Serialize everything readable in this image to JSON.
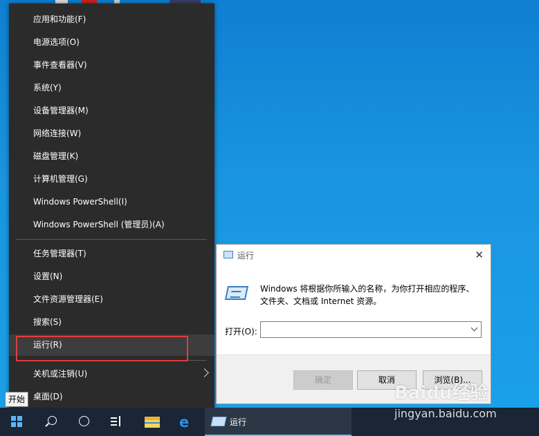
{
  "winx_menu": {
    "items": [
      {
        "label": "应用和功能(F)"
      },
      {
        "label": "电源选项(O)"
      },
      {
        "label": "事件查看器(V)"
      },
      {
        "label": "系统(Y)"
      },
      {
        "label": "设备管理器(M)"
      },
      {
        "label": "网络连接(W)"
      },
      {
        "label": "磁盘管理(K)"
      },
      {
        "label": "计算机管理(G)"
      },
      {
        "label": "Windows PowerShell(I)"
      },
      {
        "label": "Windows PowerShell (管理员)(A)"
      },
      {
        "label": "任务管理器(T)"
      },
      {
        "label": "设置(N)"
      },
      {
        "label": "文件资源管理器(E)"
      },
      {
        "label": "搜索(S)"
      },
      {
        "label": "运行(R)"
      },
      {
        "label": "关机或注销(U)"
      },
      {
        "label": "桌面(D)"
      }
    ]
  },
  "tooltip": {
    "text": "开始"
  },
  "run_dialog": {
    "title": "运行",
    "close_glyph": "✕",
    "description_line1": "Windows 将根据你所输入的名称，为你打开相应的程序、",
    "description_line2": "文件夹、文档或 Internet 资源。",
    "open_label": "打开(O):",
    "open_value": "",
    "ok_label": "确定",
    "cancel_label": "取消",
    "browse_label": "浏览(B)..."
  },
  "taskbar": {
    "running_app_label": "运行"
  },
  "watermark": {
    "brand": "Baidu经验",
    "site": "jingyan.baidu.com"
  },
  "colors": {
    "menu_bg": "#2b2b2b",
    "highlight_border": "#e23c3c",
    "taskbar_bg": "#1a2535",
    "accent": "#76b9ed"
  }
}
